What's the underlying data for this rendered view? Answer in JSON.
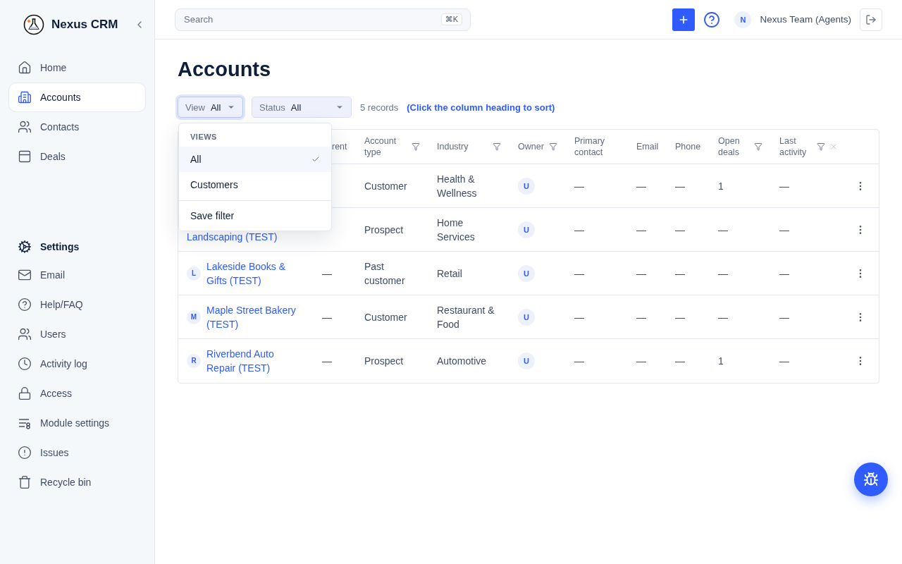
{
  "sidebar": {
    "brand": "Nexus CRM",
    "items": [
      {
        "label": "Home",
        "selected": false
      },
      {
        "label": "Accounts",
        "selected": true
      },
      {
        "label": "Contacts",
        "selected": false
      },
      {
        "label": "Deals",
        "selected": false
      }
    ],
    "settings": {
      "title": "Settings",
      "items": [
        {
          "label": "Email",
          "selected": false
        },
        {
          "label": "Help/FAQ",
          "selected": false
        },
        {
          "label": "Users",
          "selected": false
        },
        {
          "label": "Activity log",
          "selected": false
        },
        {
          "label": "Access",
          "selected": false
        },
        {
          "label": "Module settings",
          "selected": false
        },
        {
          "label": "Issues",
          "selected": false
        },
        {
          "label": "Recycle bin",
          "selected": false
        }
      ]
    }
  },
  "topbar": {
    "search": {
      "placeholder": "Search",
      "shortcut": "⌘K"
    },
    "user": {
      "initial": "N",
      "name": "Nexus Team (Agents)"
    }
  },
  "page": {
    "title": "Accounts",
    "filters": [
      {
        "label": "View",
        "value": "All",
        "focused": true
      },
      {
        "label": "Status",
        "value": "All",
        "focused": false
      }
    ],
    "record_count": "5 records",
    "sort_hint": "(Click the column heading to sort)"
  },
  "view_menu": {
    "heading": "VIEWS",
    "options": [
      {
        "label": "All",
        "selected": true
      },
      {
        "label": "Customers",
        "selected": false
      }
    ],
    "action": "Save filter"
  },
  "table": {
    "columns": [
      {
        "label": "rent",
        "filter": false,
        "clear": false
      },
      {
        "label": "Account type",
        "filter": true,
        "clear": false
      },
      {
        "label": "Industry",
        "filter": true,
        "clear": false
      },
      {
        "label": "Owner",
        "filter": true,
        "clear": false
      },
      {
        "label": "Primary contact",
        "filter": false,
        "clear": false
      },
      {
        "label": "Email",
        "filter": false,
        "clear": false
      },
      {
        "label": "Phone",
        "filter": false,
        "clear": false
      },
      {
        "label": "Open deals",
        "filter": true,
        "clear": false
      },
      {
        "label": "Last activity",
        "filter": true,
        "clear": true
      }
    ],
    "rows": [
      {
        "account_type": "Customer",
        "industry": "Health & Wellness",
        "owner": "U",
        "primary_contact": "—",
        "email": "—",
        "phone": "—",
        "open_deals": "1",
        "last_activity": "—"
      },
      {
        "name": "Landscaping (TEST)",
        "account_type": "Prospect",
        "industry": "Home Services",
        "owner": "U",
        "primary_contact": "—",
        "email": "—",
        "phone": "—",
        "open_deals": "—",
        "last_activity": "—"
      },
      {
        "initial": "L",
        "name": "Lakeside Books & Gifts (TEST)",
        "parent": "—",
        "account_type": "Past customer",
        "industry": "Retail",
        "owner": "U",
        "primary_contact": "—",
        "email": "—",
        "phone": "—",
        "open_deals": "—",
        "last_activity": "—"
      },
      {
        "initial": "M",
        "name": "Maple Street Bakery (TEST)",
        "parent": "—",
        "account_type": "Customer",
        "industry": "Restaurant & Food",
        "owner": "U",
        "primary_contact": "—",
        "email": "—",
        "phone": "—",
        "open_deals": "—",
        "last_activity": "—"
      },
      {
        "initial": "R",
        "name": "Riverbend Auto Repair (TEST)",
        "parent": "—",
        "account_type": "Prospect",
        "industry": "Automotive",
        "owner": "U",
        "primary_contact": "—",
        "email": "—",
        "phone": "—",
        "open_deals": "1",
        "last_activity": "—"
      }
    ]
  }
}
